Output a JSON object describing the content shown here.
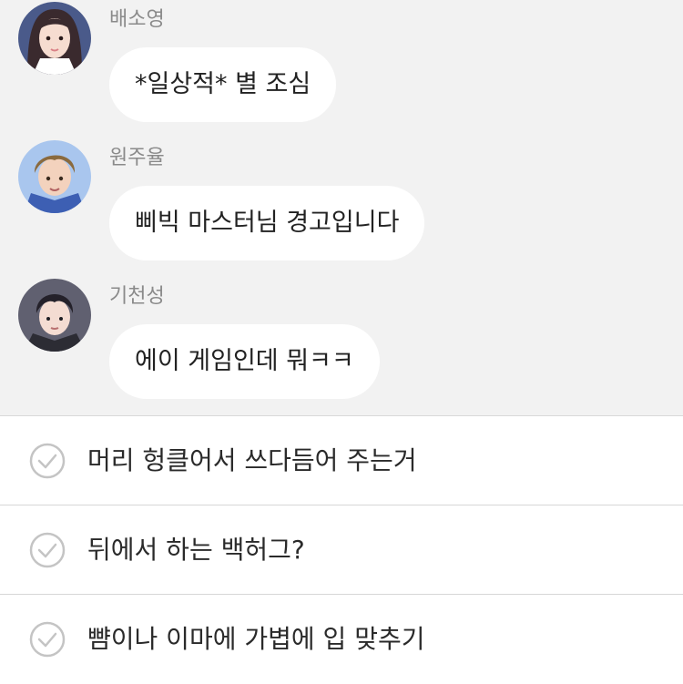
{
  "messages": [
    {
      "sender": "배소영",
      "text": "*일상적* 별 조심",
      "avatar": "female-avatar"
    },
    {
      "sender": "원주율",
      "text": "삐빅 마스터님 경고입니다",
      "avatar": "male-avatar-light-hair"
    },
    {
      "sender": "기천성",
      "text": "에이 게임인데 뭐ㅋㅋ",
      "avatar": "male-avatar-dark-hair"
    }
  ],
  "choices": [
    {
      "text": "머리 헝클어서 쓰다듬어 주는거",
      "icon": "check-circle-icon"
    },
    {
      "text": "뒤에서 하는 백허그?",
      "icon": "check-circle-icon"
    },
    {
      "text": "뺨이나 이마에 가볍에 입 맞추기",
      "icon": "check-circle-icon"
    }
  ],
  "colors": {
    "chat_background": "#f2f2f2",
    "bubble": "#ffffff",
    "sender_name": "#8a8a8a",
    "divider": "#d6d6d6",
    "check_icon": "#c4c4c4"
  }
}
